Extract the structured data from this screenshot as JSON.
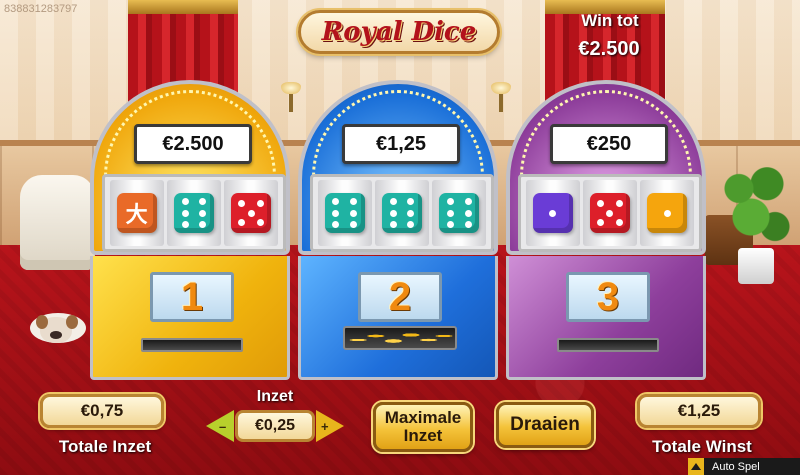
{
  "game_id": "838831283797",
  "logo": {
    "text": "Royal Dice"
  },
  "win_tot": {
    "label": "Win tot",
    "value": "€2.500"
  },
  "machines": [
    {
      "prize": "€2.500",
      "number": "1",
      "color": "#f0b30d",
      "slot": "empty",
      "dice": [
        {
          "color": "#e96a28",
          "face": "glyph",
          "glyph": "大"
        },
        {
          "color": "#1fb3a3",
          "face": 6
        },
        {
          "color": "#dd1f2a",
          "face": 5
        }
      ]
    },
    {
      "prize": "€1,25",
      "number": "2",
      "color": "#1f6fdb",
      "slot": "coins",
      "dice": [
        {
          "color": "#1fb3a3",
          "face": 6
        },
        {
          "color": "#1fb3a3",
          "face": 6
        },
        {
          "color": "#1fb3a3",
          "face": 6
        }
      ]
    },
    {
      "prize": "€250",
      "number": "3",
      "color": "#8e3f9c",
      "slot": "empty",
      "dice": [
        {
          "color": "#6a3cd6",
          "face": 1
        },
        {
          "color": "#dd1f2a",
          "face": 5
        },
        {
          "color": "#f5a50d",
          "face": 1
        }
      ]
    }
  ],
  "controls": {
    "totale_inzet": {
      "value": "€0,75",
      "label": "Totale Inzet"
    },
    "inzet": {
      "label": "Inzet",
      "value": "€0,25",
      "minus": "–",
      "plus": "+"
    },
    "max_bet_label": "Maximale Inzet",
    "spin_label": "Draaien",
    "totale_winst": {
      "value": "€1,25",
      "label": "Totale Winst"
    },
    "auto_spel": "Auto Spel"
  }
}
